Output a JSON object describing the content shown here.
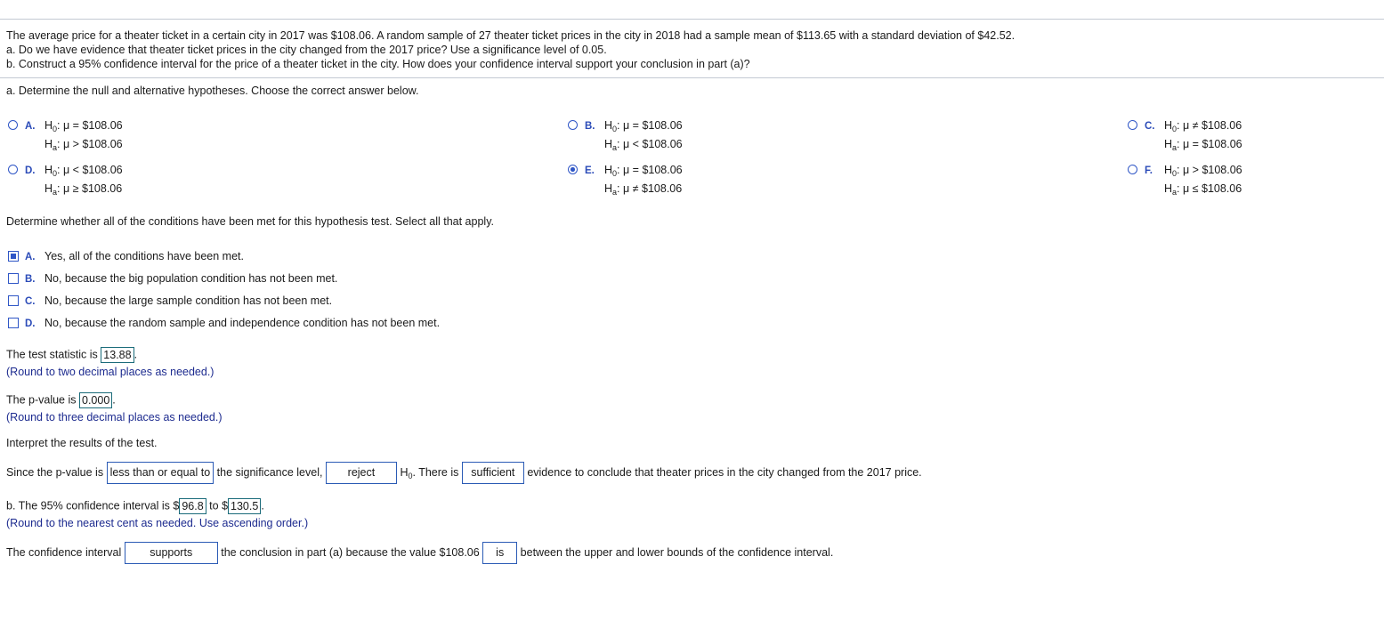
{
  "problem": {
    "line1": "The average price for a theater ticket in a certain city in 2017 was $108.06. A random sample of 27 theater ticket prices in the city in 2018 had a sample mean of $113.65 with a standard deviation of $42.52.",
    "line2": "a. Do we have evidence that theater ticket prices in the city changed from the 2017 price? Use a significance level of 0.05.",
    "line3": "b. Construct a 95% confidence interval for the price of a theater ticket in the city. How does your confidence interval support your conclusion in part (a)?"
  },
  "part_a": {
    "prompt": "a. Determine the null and alternative hypotheses. Choose the correct answer below.",
    "options": [
      {
        "label": "A.",
        "h0": "μ = $108.06",
        "ha": "μ > $108.06",
        "selected": false
      },
      {
        "label": "B.",
        "h0": "μ = $108.06",
        "ha": "μ < $108.06",
        "selected": false
      },
      {
        "label": "C.",
        "h0": "μ ≠ $108.06",
        "ha": "μ = $108.06",
        "selected": false
      },
      {
        "label": "D.",
        "h0": "μ < $108.06",
        "ha": "μ ≥ $108.06",
        "selected": false
      },
      {
        "label": "E.",
        "h0": "μ = $108.06",
        "ha": "μ ≠ $108.06",
        "selected": true
      },
      {
        "label": "F.",
        "h0": "μ > $108.06",
        "ha": "μ ≤ $108.06",
        "selected": false
      }
    ],
    "h_symbol": "H",
    "h0_sub": "0",
    "ha_sub": "a"
  },
  "conditions": {
    "prompt": "Determine whether all of the conditions have been met for this hypothesis test. Select all that apply.",
    "options": [
      {
        "label": "A.",
        "text": "Yes, all of the conditions have been met.",
        "checked": true
      },
      {
        "label": "B.",
        "text": "No, because the big population condition has not been met.",
        "checked": false
      },
      {
        "label": "C.",
        "text": "No, because the large sample condition has not been met.",
        "checked": false
      },
      {
        "label": "D.",
        "text": "No, because the random sample and independence condition has not been met.",
        "checked": false
      }
    ]
  },
  "test_statistic": {
    "prefix": "The test statistic is",
    "value": "13.88",
    "suffix": ".",
    "hint": "(Round to two decimal places as needed.)"
  },
  "p_value": {
    "prefix": "The p-value is",
    "value": "0.000",
    "suffix": ".",
    "hint": "(Round to three decimal places as needed.)"
  },
  "interpret": {
    "prompt": "Interpret the results of the test.",
    "s1": "Since the p-value is",
    "dd1": "less than or equal to",
    "s2": "the significance level,",
    "dd2": "reject",
    "s3_h": "H",
    "s3_sub": "0",
    "s3": ". There is",
    "dd3": "sufficient",
    "s4": "evidence to conclude that theater prices in the city changed from the 2017 price."
  },
  "part_b": {
    "prefix": "b. The 95% confidence interval is $",
    "lower": "96.8",
    "mid": "to $",
    "upper": "130.5",
    "suffix": ".",
    "hint": "(Round to the nearest cent as needed. Use ascending order.)"
  },
  "ci_conclusion": {
    "s1": "The confidence interval",
    "dd1": "supports",
    "s2": "the conclusion in part (a) because the value $108.06",
    "dd2": "is",
    "s3": "between the upper and lower bounds of the confidence interval."
  }
}
